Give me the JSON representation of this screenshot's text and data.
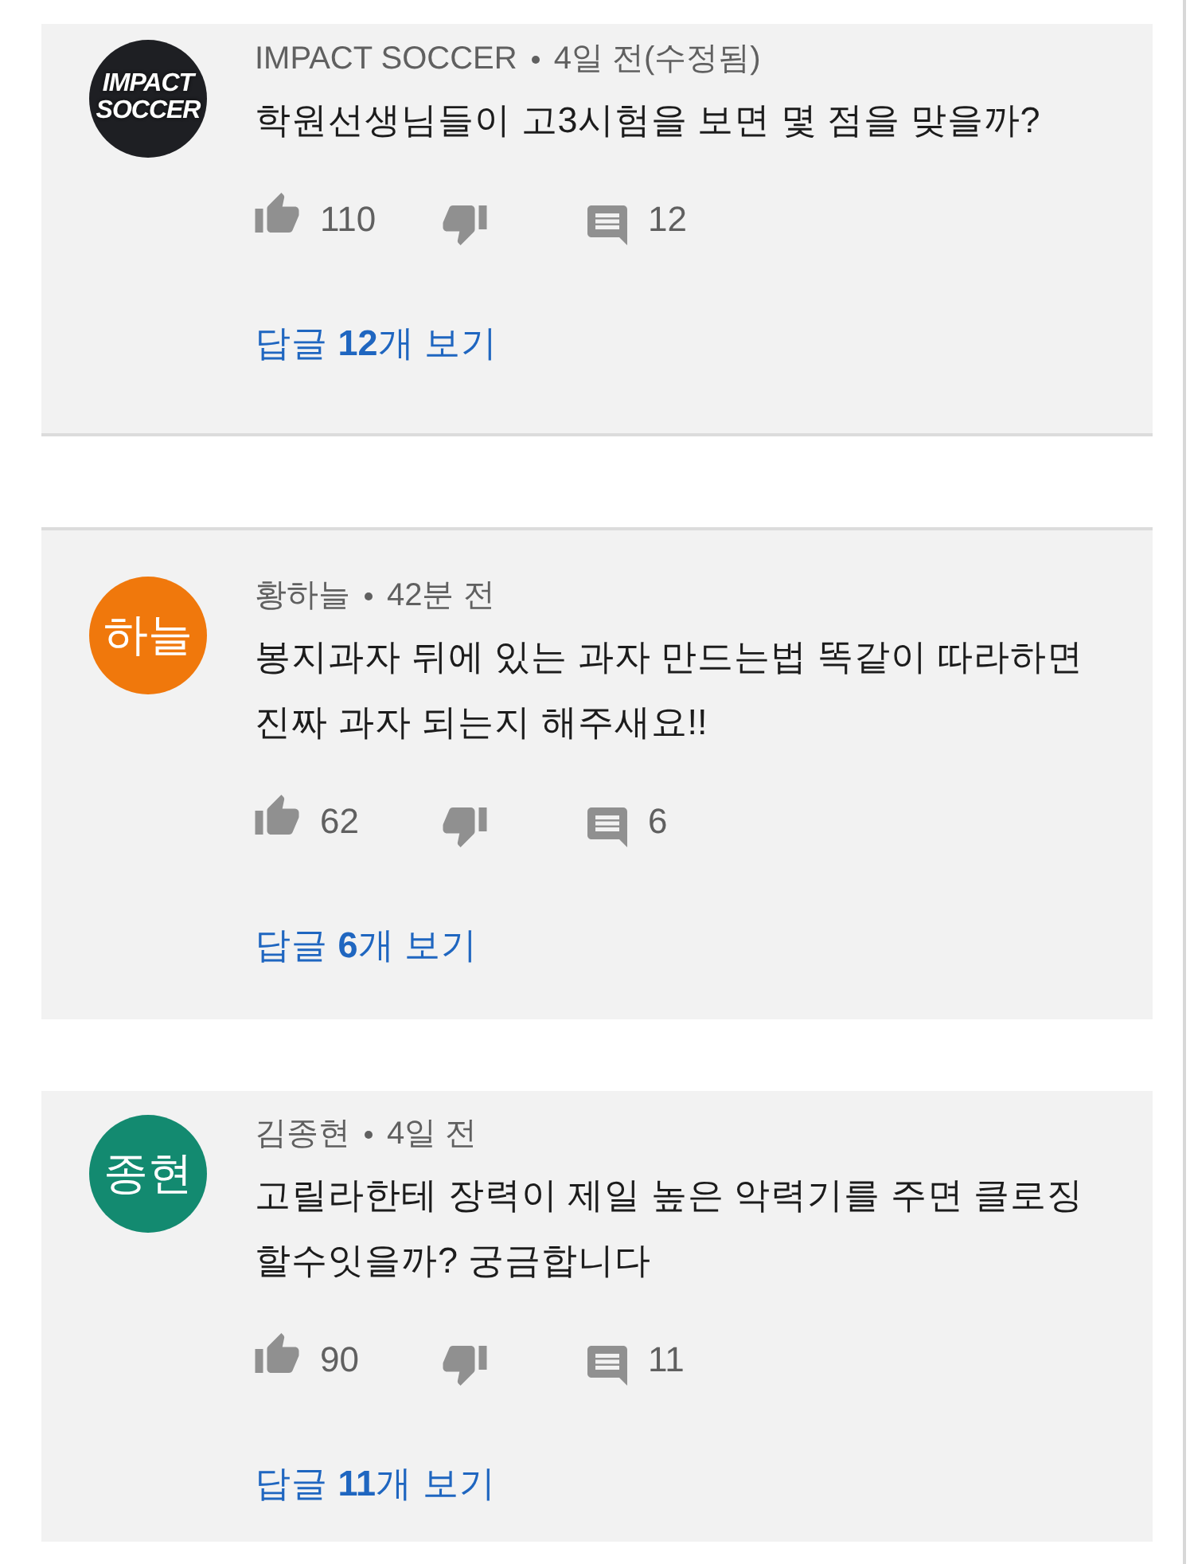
{
  "comments": [
    {
      "avatar": {
        "kind": "logo",
        "text": "IMPACT SOCCER",
        "color": "#1e1f23"
      },
      "author": "IMPACT SOCCER",
      "time": "4일 전(수정됨)",
      "text": "학원선생님들이 고3시험을 보면 몇 점을 맞을까?",
      "likes": "110",
      "comment_count": "12",
      "view_replies": "답글 **12**개 보기"
    },
    {
      "avatar": {
        "kind": "initials",
        "text": "하늘",
        "color": "#f0780c"
      },
      "author": "황하늘",
      "time": "42분 전",
      "text": "봉지과자 뒤에 있는 과자 만드는법 똑같이 따라하면\n진짜 과자 되는지 해주새요!!",
      "likes": "62",
      "comment_count": "6",
      "view_replies": "답글 **6**개 보기"
    },
    {
      "avatar": {
        "kind": "initials",
        "text": "종현",
        "color": "#138a70"
      },
      "author": "김종현",
      "time": "4일 전",
      "text": "고릴라한테 장력이 제일 높은 악력기를 주면 클로징\n할수잇을까? 궁금합니다",
      "likes": "90",
      "comment_count": "11",
      "view_replies": "답글 **11**개 보기"
    }
  ]
}
